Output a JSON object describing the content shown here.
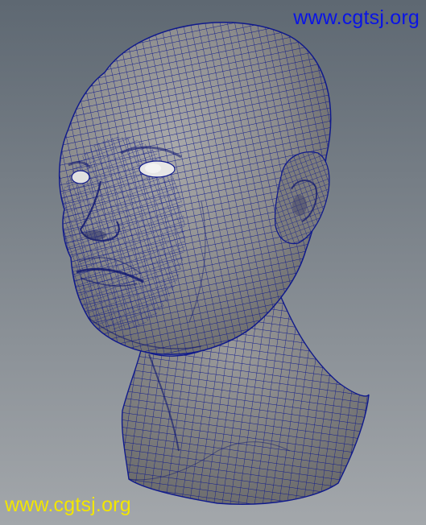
{
  "viewport": {
    "model": "head-mesh-wireframe",
    "background_top": "#5e6872",
    "background_bottom": "#a3a7ab",
    "mesh_fill": "#8a8a8a",
    "wire_color": "#101a8c"
  },
  "watermark_top": {
    "text": "www.cgtsj.org",
    "color": "#0a14e6"
  },
  "watermark_bottom": {
    "text": "www.cgtsj.org",
    "color": "#f2e600"
  }
}
